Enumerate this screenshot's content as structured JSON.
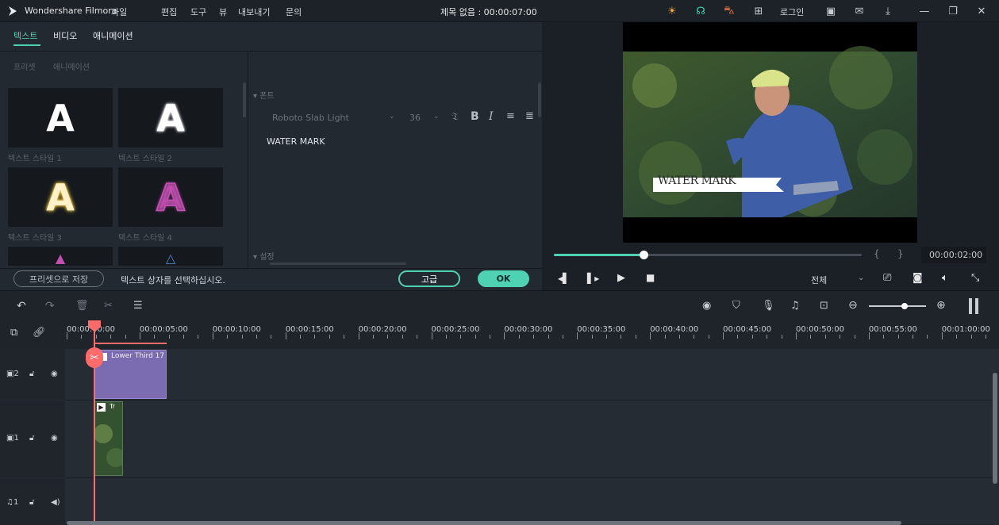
{
  "app": {
    "name": "Wondershare Filmora",
    "document": "제목 없음 : 00:00:07:00"
  },
  "menu": [
    "파일",
    "편집",
    "도구",
    "뷰",
    "내보내기",
    "문의"
  ],
  "titlebar_right": {
    "login": "로그인"
  },
  "tabs": [
    "텍스트",
    "비디오",
    "애니메이션"
  ],
  "subtabs": [
    "프리셋",
    "애니메이션"
  ],
  "presets": [
    "텍스트 스타일 1",
    "텍스트 스타일 2",
    "텍스트 스타일 3",
    "텍스트 스타일 4"
  ],
  "props": {
    "font_section": "폰트",
    "font_name": "Roboto Slab Light",
    "font_size": "36",
    "text_value": "WATER MARK",
    "settings_section": "설정"
  },
  "bottom": {
    "save_preset": "프리셋으로 저장",
    "hint": "텍스트 상자를 선택하십시오.",
    "advanced": "고급",
    "ok": "OK"
  },
  "preview": {
    "watermark": "WATER MARK",
    "time": "00:00:02:00",
    "playhead_progress": 0.25,
    "brace_open": "{",
    "brace_close": "}",
    "zoom_select": "전체"
  },
  "ruler": [
    "00:00:00:00",
    "00:00:05:00",
    "00:00:10:00",
    "00:00:15:00",
    "00:00:20:00",
    "00:00:25:00",
    "00:00:30:00",
    "00:00:35:00",
    "00:00:40:00",
    "00:00:45:00",
    "00:00:50:00",
    "00:00:55:00",
    "00:01:00:00"
  ],
  "tracks": {
    "track2_num": "2",
    "track1_num": "1",
    "audio_num": "1",
    "title_clip": "Lower Third 17",
    "video_clip": "Tr"
  },
  "colors": {
    "accent": "#4fd1b3",
    "playhead": "#ff6b6b",
    "title_clip": "#7b6bb0"
  }
}
